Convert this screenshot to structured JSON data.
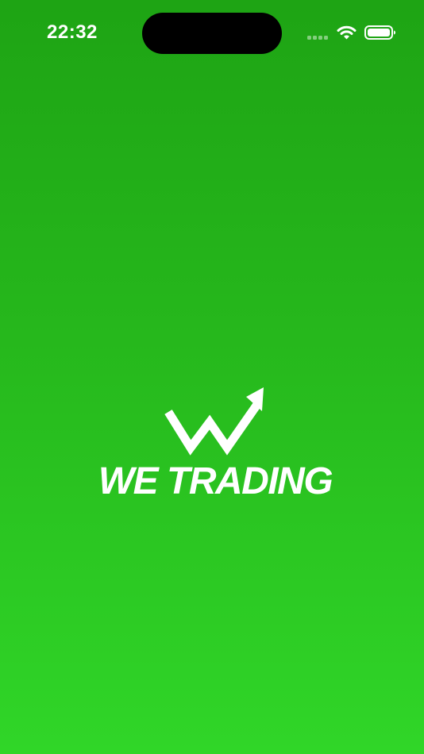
{
  "status_bar": {
    "time": "22:32",
    "signal_icon": "cellular-signal-icon",
    "wifi_icon": "wifi-icon",
    "battery_icon": "battery-icon",
    "battery_level": 1.0
  },
  "splash": {
    "logo_text": "WE TRADING",
    "logo_icon": "trend-up-arrow-icon",
    "background_top": "#1ea414",
    "background_bottom": "#30d628",
    "logo_color": "#ffffff"
  }
}
